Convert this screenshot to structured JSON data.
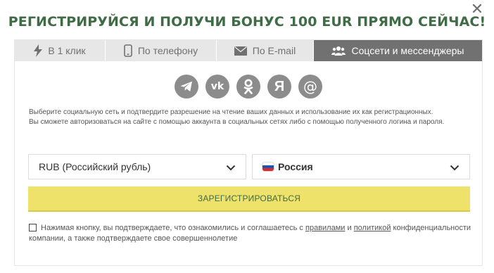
{
  "title": "РЕГИСТРИРУЙСЯ И ПОЛУЧИ БОНУС 100 EUR ПРЯМО СЕЙЧАС!",
  "close_icon": "close-icon",
  "tabs": [
    {
      "label": "В 1 клик",
      "icon": "lightning-icon",
      "active": false
    },
    {
      "label": "По телефону",
      "icon": "phone-icon",
      "active": false
    },
    {
      "label": "По E-mail",
      "icon": "envelope-icon",
      "active": false
    },
    {
      "label": "Соцсети и мессенджеры",
      "icon": "users-icon",
      "active": true
    }
  ],
  "socials": [
    {
      "name": "telegram-icon"
    },
    {
      "name": "vk-icon"
    },
    {
      "name": "odnoklassniki-icon"
    },
    {
      "name": "yandex-icon"
    },
    {
      "name": "mail-at-icon"
    }
  ],
  "description": {
    "line1": "Выберите социальную сеть и подтвердите разрешение на чтение ваших данных и использование их как регистрационных.",
    "line2": "Вы сможете авторизоваться на сайте с помощью аккаунта в социальных сетях либо с помощью полученного логина и пароля."
  },
  "currency_select": {
    "value": "RUB (Российский рубль)"
  },
  "country_select": {
    "value": "Россия"
  },
  "register_button": "ЗАРЕГИСТРИРОВАТЬСЯ",
  "agreement": {
    "checked": false,
    "text_before": "Нажимая кнопку, вы подтверждаете, что ознакомились и соглашаетесь с ",
    "link_rules": "правилами",
    "text_and": " и ",
    "link_policy": "политикой",
    "text_after": " конфиденциальности компании, а также подтверждаете свое совершеннолетие"
  },
  "colors": {
    "title_green": "#3f6b46",
    "active_tab": "#717171",
    "register_yellow": "#efe26a",
    "social_grey": "#8c8c8c"
  }
}
